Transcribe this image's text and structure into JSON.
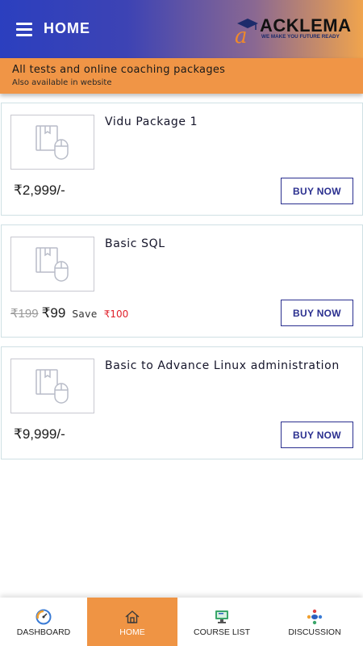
{
  "header": {
    "title": "HOME",
    "logo": {
      "name": "ACKLEMA",
      "tagline": "WE MAKE YOU FUTURE READY",
      "mark_letter": "a"
    }
  },
  "banner": {
    "title": "All tests and online coaching packages",
    "subtitle": "Also available in website"
  },
  "packages": [
    {
      "name": "Vidu Package 1",
      "price": "₹2,999/-",
      "button": "BUY NOW"
    },
    {
      "name": "Basic SQL",
      "old_price": "₹199",
      "price": "₹99",
      "save_label": "Save",
      "save_amount": "₹100",
      "button": "BUY NOW"
    },
    {
      "name": "Basic to Advance Linux administration",
      "price": "₹9,999/-",
      "button": "BUY NOW"
    }
  ],
  "bottom_nav": [
    {
      "label": "DASHBOARD",
      "icon": "dashboard-gauge-icon"
    },
    {
      "label": "HOME",
      "icon": "home-icon",
      "active": true
    },
    {
      "label": "COURSE LIST",
      "icon": "course-list-icon"
    },
    {
      "label": "DISCUSSION",
      "icon": "discussion-icon"
    }
  ],
  "colors": {
    "header_gradient_start": "#2b3fbf",
    "header_gradient_end": "#f0a44d",
    "banner": "#f09546",
    "buy_button": "#2a2f8f",
    "save_amount": "#e0202a",
    "nav_active": "#ef9444"
  }
}
